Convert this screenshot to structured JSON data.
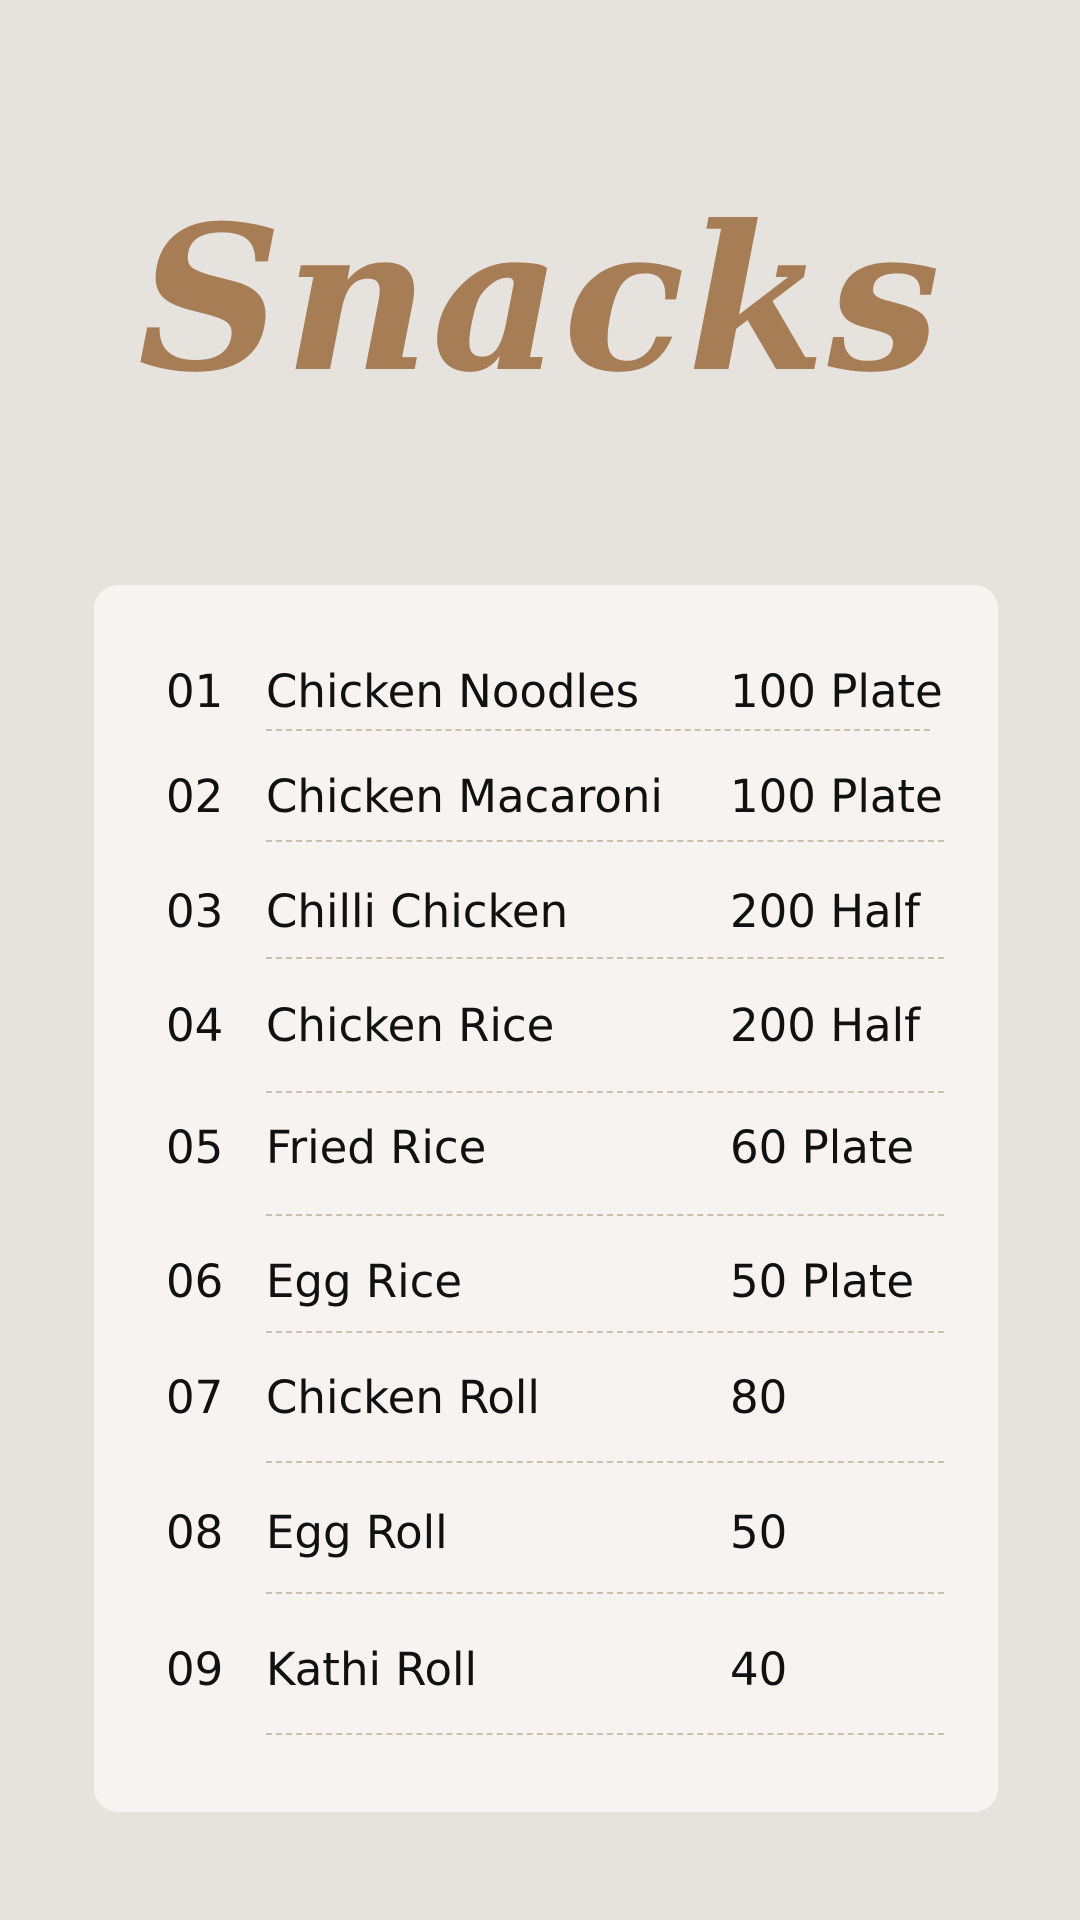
{
  "title": "Snacks",
  "menu": {
    "items": [
      {
        "number": "01",
        "name": "Chicken Noodles",
        "price": "100 Plate"
      },
      {
        "number": "02",
        "name": "Chicken Macaroni",
        "price": "100 Plate"
      },
      {
        "number": "03",
        "name": "Chilli Chicken",
        "price": "200 Half"
      },
      {
        "number": "04",
        "name": "Chicken Rice",
        "price": "200 Half"
      },
      {
        "number": "05",
        "name": "Fried Rice",
        "price": "60 Plate"
      },
      {
        "number": "06",
        "name": "Egg Rice",
        "price": "50 Plate"
      },
      {
        "number": "07",
        "name": "Chicken Roll",
        "price": "80"
      },
      {
        "number": "08",
        "name": "Egg Roll",
        "price": "50"
      },
      {
        "number": "09",
        "name": "Kathi Roll",
        "price": "40"
      }
    ]
  },
  "colors": {
    "background": "#e6e3de",
    "card": "#f7f3f1",
    "title": "#a77d55",
    "text": "#111111",
    "divider": "#c9c2b1"
  }
}
